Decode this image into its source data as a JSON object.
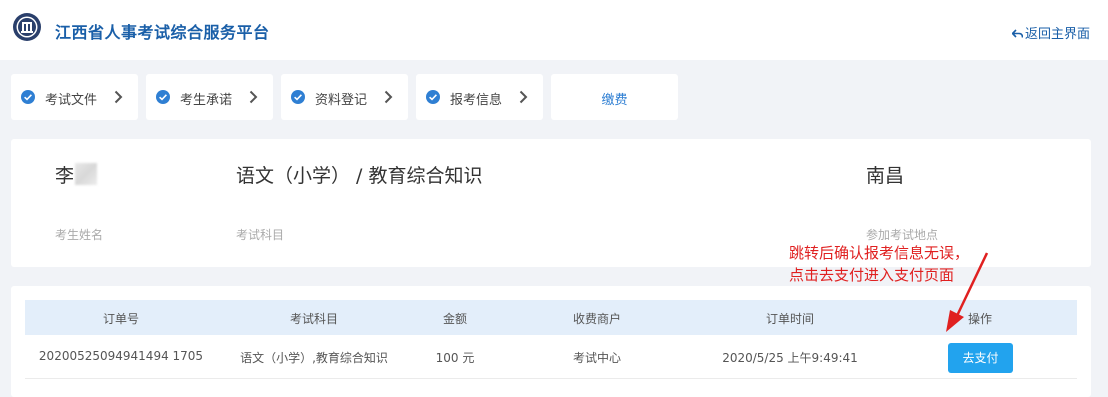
{
  "header": {
    "site_title": "江西省人事考试综合服务平台",
    "back_label": "返回主界面",
    "brand_color": "#1a5fa8"
  },
  "steps": [
    {
      "label": "考试文件",
      "done": true
    },
    {
      "label": "考生承诺",
      "done": true
    },
    {
      "label": "资料登记",
      "done": true
    },
    {
      "label": "报考信息",
      "done": true
    },
    {
      "label": "缴费",
      "current": true
    }
  ],
  "candidate": {
    "name_visible": "李",
    "name_label": "考生姓名",
    "subject": "语文（小学） / 教育综合知识",
    "subject_label": "考试科目",
    "location": "南昌",
    "location_label": "参加考试地点"
  },
  "orders": {
    "columns": [
      "订单号",
      "考试科目",
      "金额",
      "收费商户",
      "订单时间",
      "操作"
    ],
    "rows": [
      {
        "order_no": "20200525094941494 1705",
        "subject": "语文（小学）,教育综合知识",
        "amount": "100 元",
        "merchant": "考试中心",
        "time": "2020/5/25 上午9:49:41",
        "action": "去支付"
      }
    ]
  },
  "annotation": {
    "text": "跳转后确认报考信息无误，点击去支付进入支付页面",
    "color": "#e02020"
  },
  "accent": {
    "pay_button": "#22a3ee",
    "table_head_bg": "#e3eefa",
    "check_icon": "#2f7fd3"
  }
}
